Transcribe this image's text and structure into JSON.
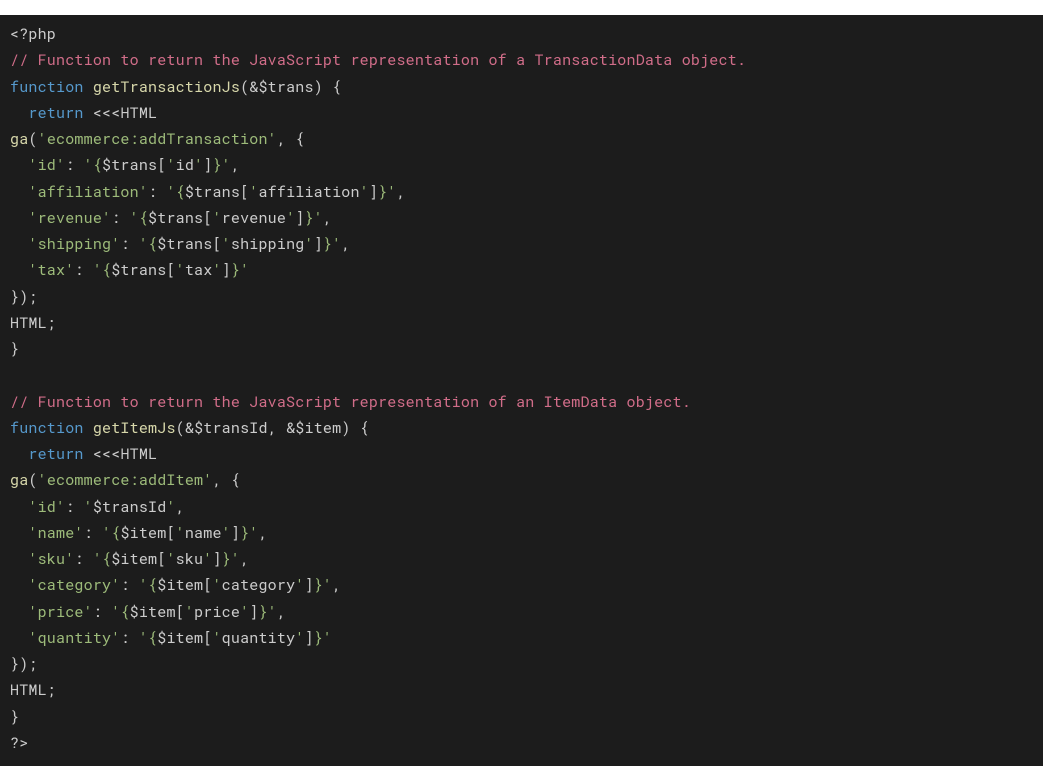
{
  "code": {
    "lines": [
      [
        {
          "cls": "tok-tag",
          "t": "<?php"
        }
      ],
      [
        {
          "cls": "tok-comment",
          "t": "// Function to return the JavaScript representation of a TransactionData object."
        }
      ],
      [
        {
          "cls": "tok-kw",
          "t": "function"
        },
        {
          "cls": "tok-punc",
          "t": " "
        },
        {
          "cls": "tok-fn",
          "t": "getTransactionJs"
        },
        {
          "cls": "tok-punc",
          "t": "(&"
        },
        {
          "cls": "tok-var",
          "t": "$trans"
        },
        {
          "cls": "tok-punc",
          "t": ") {"
        }
      ],
      [
        {
          "cls": "tok-punc",
          "t": "  "
        },
        {
          "cls": "tok-kw",
          "t": "return"
        },
        {
          "cls": "tok-punc",
          "t": " "
        },
        {
          "cls": "tok-op",
          "t": "<<<"
        },
        {
          "cls": "tok-heredoc",
          "t": "HTML"
        }
      ],
      [
        {
          "cls": "tok-fn",
          "t": "ga"
        },
        {
          "cls": "tok-punc",
          "t": "("
        },
        {
          "cls": "tok-q",
          "t": "'"
        },
        {
          "cls": "tok-str",
          "t": "ecommerce:addTransaction"
        },
        {
          "cls": "tok-q",
          "t": "'"
        },
        {
          "cls": "tok-punc",
          "t": ", {"
        }
      ],
      [
        {
          "cls": "tok-punc",
          "t": "  "
        },
        {
          "cls": "tok-q",
          "t": "'"
        },
        {
          "cls": "tok-str",
          "t": "id"
        },
        {
          "cls": "tok-q",
          "t": "'"
        },
        {
          "cls": "tok-punc",
          "t": ": "
        },
        {
          "cls": "tok-q",
          "t": "'"
        },
        {
          "cls": "tok-str",
          "t": "{"
        },
        {
          "cls": "tok-int",
          "t": "$trans["
        },
        {
          "cls": "tok-q",
          "t": "'"
        },
        {
          "cls": "tok-int",
          "t": "id"
        },
        {
          "cls": "tok-q",
          "t": "'"
        },
        {
          "cls": "tok-int",
          "t": "]"
        },
        {
          "cls": "tok-str",
          "t": "}"
        },
        {
          "cls": "tok-q",
          "t": "'"
        },
        {
          "cls": "tok-punc",
          "t": ","
        }
      ],
      [
        {
          "cls": "tok-punc",
          "t": "  "
        },
        {
          "cls": "tok-q",
          "t": "'"
        },
        {
          "cls": "tok-str",
          "t": "affiliation"
        },
        {
          "cls": "tok-q",
          "t": "'"
        },
        {
          "cls": "tok-punc",
          "t": ": "
        },
        {
          "cls": "tok-q",
          "t": "'"
        },
        {
          "cls": "tok-str",
          "t": "{"
        },
        {
          "cls": "tok-int",
          "t": "$trans["
        },
        {
          "cls": "tok-q",
          "t": "'"
        },
        {
          "cls": "tok-int",
          "t": "affiliation"
        },
        {
          "cls": "tok-q",
          "t": "'"
        },
        {
          "cls": "tok-int",
          "t": "]"
        },
        {
          "cls": "tok-str",
          "t": "}"
        },
        {
          "cls": "tok-q",
          "t": "'"
        },
        {
          "cls": "tok-punc",
          "t": ","
        }
      ],
      [
        {
          "cls": "tok-punc",
          "t": "  "
        },
        {
          "cls": "tok-q",
          "t": "'"
        },
        {
          "cls": "tok-str",
          "t": "revenue"
        },
        {
          "cls": "tok-q",
          "t": "'"
        },
        {
          "cls": "tok-punc",
          "t": ": "
        },
        {
          "cls": "tok-q",
          "t": "'"
        },
        {
          "cls": "tok-str",
          "t": "{"
        },
        {
          "cls": "tok-int",
          "t": "$trans["
        },
        {
          "cls": "tok-q",
          "t": "'"
        },
        {
          "cls": "tok-int",
          "t": "revenue"
        },
        {
          "cls": "tok-q",
          "t": "'"
        },
        {
          "cls": "tok-int",
          "t": "]"
        },
        {
          "cls": "tok-str",
          "t": "}"
        },
        {
          "cls": "tok-q",
          "t": "'"
        },
        {
          "cls": "tok-punc",
          "t": ","
        }
      ],
      [
        {
          "cls": "tok-punc",
          "t": "  "
        },
        {
          "cls": "tok-q",
          "t": "'"
        },
        {
          "cls": "tok-str",
          "t": "shipping"
        },
        {
          "cls": "tok-q",
          "t": "'"
        },
        {
          "cls": "tok-punc",
          "t": ": "
        },
        {
          "cls": "tok-q",
          "t": "'"
        },
        {
          "cls": "tok-str",
          "t": "{"
        },
        {
          "cls": "tok-int",
          "t": "$trans["
        },
        {
          "cls": "tok-q",
          "t": "'"
        },
        {
          "cls": "tok-int",
          "t": "shipping"
        },
        {
          "cls": "tok-q",
          "t": "'"
        },
        {
          "cls": "tok-int",
          "t": "]"
        },
        {
          "cls": "tok-str",
          "t": "}"
        },
        {
          "cls": "tok-q",
          "t": "'"
        },
        {
          "cls": "tok-punc",
          "t": ","
        }
      ],
      [
        {
          "cls": "tok-punc",
          "t": "  "
        },
        {
          "cls": "tok-q",
          "t": "'"
        },
        {
          "cls": "tok-str",
          "t": "tax"
        },
        {
          "cls": "tok-q",
          "t": "'"
        },
        {
          "cls": "tok-punc",
          "t": ": "
        },
        {
          "cls": "tok-q",
          "t": "'"
        },
        {
          "cls": "tok-str",
          "t": "{"
        },
        {
          "cls": "tok-int",
          "t": "$trans["
        },
        {
          "cls": "tok-q",
          "t": "'"
        },
        {
          "cls": "tok-int",
          "t": "tax"
        },
        {
          "cls": "tok-q",
          "t": "'"
        },
        {
          "cls": "tok-int",
          "t": "]"
        },
        {
          "cls": "tok-str",
          "t": "}"
        },
        {
          "cls": "tok-q",
          "t": "'"
        }
      ],
      [
        {
          "cls": "tok-punc",
          "t": "});"
        }
      ],
      [
        {
          "cls": "tok-heredoc",
          "t": "HTML;"
        }
      ],
      [
        {
          "cls": "tok-punc",
          "t": "}"
        }
      ],
      [
        {
          "cls": "tok-punc",
          "t": ""
        }
      ],
      [
        {
          "cls": "tok-comment",
          "t": "// Function to return the JavaScript representation of an ItemData object."
        }
      ],
      [
        {
          "cls": "tok-kw",
          "t": "function"
        },
        {
          "cls": "tok-punc",
          "t": " "
        },
        {
          "cls": "tok-fn",
          "t": "getItemJs"
        },
        {
          "cls": "tok-punc",
          "t": "(&"
        },
        {
          "cls": "tok-var",
          "t": "$transId"
        },
        {
          "cls": "tok-punc",
          "t": ", &"
        },
        {
          "cls": "tok-var",
          "t": "$item"
        },
        {
          "cls": "tok-punc",
          "t": ") {"
        }
      ],
      [
        {
          "cls": "tok-punc",
          "t": "  "
        },
        {
          "cls": "tok-kw",
          "t": "return"
        },
        {
          "cls": "tok-punc",
          "t": " "
        },
        {
          "cls": "tok-op",
          "t": "<<<"
        },
        {
          "cls": "tok-heredoc",
          "t": "HTML"
        }
      ],
      [
        {
          "cls": "tok-fn",
          "t": "ga"
        },
        {
          "cls": "tok-punc",
          "t": "("
        },
        {
          "cls": "tok-q",
          "t": "'"
        },
        {
          "cls": "tok-str",
          "t": "ecommerce:addItem"
        },
        {
          "cls": "tok-q",
          "t": "'"
        },
        {
          "cls": "tok-punc",
          "t": ", {"
        }
      ],
      [
        {
          "cls": "tok-punc",
          "t": "  "
        },
        {
          "cls": "tok-q",
          "t": "'"
        },
        {
          "cls": "tok-str",
          "t": "id"
        },
        {
          "cls": "tok-q",
          "t": "'"
        },
        {
          "cls": "tok-punc",
          "t": ": "
        },
        {
          "cls": "tok-q",
          "t": "'"
        },
        {
          "cls": "tok-int",
          "t": "$transId"
        },
        {
          "cls": "tok-q",
          "t": "'"
        },
        {
          "cls": "tok-punc",
          "t": ","
        }
      ],
      [
        {
          "cls": "tok-punc",
          "t": "  "
        },
        {
          "cls": "tok-q",
          "t": "'"
        },
        {
          "cls": "tok-str",
          "t": "name"
        },
        {
          "cls": "tok-q",
          "t": "'"
        },
        {
          "cls": "tok-punc",
          "t": ": "
        },
        {
          "cls": "tok-q",
          "t": "'"
        },
        {
          "cls": "tok-str",
          "t": "{"
        },
        {
          "cls": "tok-int",
          "t": "$item["
        },
        {
          "cls": "tok-q",
          "t": "'"
        },
        {
          "cls": "tok-int",
          "t": "name"
        },
        {
          "cls": "tok-q",
          "t": "'"
        },
        {
          "cls": "tok-int",
          "t": "]"
        },
        {
          "cls": "tok-str",
          "t": "}"
        },
        {
          "cls": "tok-q",
          "t": "'"
        },
        {
          "cls": "tok-punc",
          "t": ","
        }
      ],
      [
        {
          "cls": "tok-punc",
          "t": "  "
        },
        {
          "cls": "tok-q",
          "t": "'"
        },
        {
          "cls": "tok-str",
          "t": "sku"
        },
        {
          "cls": "tok-q",
          "t": "'"
        },
        {
          "cls": "tok-punc",
          "t": ": "
        },
        {
          "cls": "tok-q",
          "t": "'"
        },
        {
          "cls": "tok-str",
          "t": "{"
        },
        {
          "cls": "tok-int",
          "t": "$item["
        },
        {
          "cls": "tok-q",
          "t": "'"
        },
        {
          "cls": "tok-int",
          "t": "sku"
        },
        {
          "cls": "tok-q",
          "t": "'"
        },
        {
          "cls": "tok-int",
          "t": "]"
        },
        {
          "cls": "tok-str",
          "t": "}"
        },
        {
          "cls": "tok-q",
          "t": "'"
        },
        {
          "cls": "tok-punc",
          "t": ","
        }
      ],
      [
        {
          "cls": "tok-punc",
          "t": "  "
        },
        {
          "cls": "tok-q",
          "t": "'"
        },
        {
          "cls": "tok-str",
          "t": "category"
        },
        {
          "cls": "tok-q",
          "t": "'"
        },
        {
          "cls": "tok-punc",
          "t": ": "
        },
        {
          "cls": "tok-q",
          "t": "'"
        },
        {
          "cls": "tok-str",
          "t": "{"
        },
        {
          "cls": "tok-int",
          "t": "$item["
        },
        {
          "cls": "tok-q",
          "t": "'"
        },
        {
          "cls": "tok-int",
          "t": "category"
        },
        {
          "cls": "tok-q",
          "t": "'"
        },
        {
          "cls": "tok-int",
          "t": "]"
        },
        {
          "cls": "tok-str",
          "t": "}"
        },
        {
          "cls": "tok-q",
          "t": "'"
        },
        {
          "cls": "tok-punc",
          "t": ","
        }
      ],
      [
        {
          "cls": "tok-punc",
          "t": "  "
        },
        {
          "cls": "tok-q",
          "t": "'"
        },
        {
          "cls": "tok-str",
          "t": "price"
        },
        {
          "cls": "tok-q",
          "t": "'"
        },
        {
          "cls": "tok-punc",
          "t": ": "
        },
        {
          "cls": "tok-q",
          "t": "'"
        },
        {
          "cls": "tok-str",
          "t": "{"
        },
        {
          "cls": "tok-int",
          "t": "$item["
        },
        {
          "cls": "tok-q",
          "t": "'"
        },
        {
          "cls": "tok-int",
          "t": "price"
        },
        {
          "cls": "tok-q",
          "t": "'"
        },
        {
          "cls": "tok-int",
          "t": "]"
        },
        {
          "cls": "tok-str",
          "t": "}"
        },
        {
          "cls": "tok-q",
          "t": "'"
        },
        {
          "cls": "tok-punc",
          "t": ","
        }
      ],
      [
        {
          "cls": "tok-punc",
          "t": "  "
        },
        {
          "cls": "tok-q",
          "t": "'"
        },
        {
          "cls": "tok-str",
          "t": "quantity"
        },
        {
          "cls": "tok-q",
          "t": "'"
        },
        {
          "cls": "tok-punc",
          "t": ": "
        },
        {
          "cls": "tok-q",
          "t": "'"
        },
        {
          "cls": "tok-str",
          "t": "{"
        },
        {
          "cls": "tok-int",
          "t": "$item["
        },
        {
          "cls": "tok-q",
          "t": "'"
        },
        {
          "cls": "tok-int",
          "t": "quantity"
        },
        {
          "cls": "tok-q",
          "t": "'"
        },
        {
          "cls": "tok-int",
          "t": "]"
        },
        {
          "cls": "tok-str",
          "t": "}"
        },
        {
          "cls": "tok-q",
          "t": "'"
        }
      ],
      [
        {
          "cls": "tok-punc",
          "t": "});"
        }
      ],
      [
        {
          "cls": "tok-heredoc",
          "t": "HTML;"
        }
      ],
      [
        {
          "cls": "tok-punc",
          "t": "}"
        }
      ],
      [
        {
          "cls": "tok-tag",
          "t": "?>"
        }
      ]
    ]
  }
}
